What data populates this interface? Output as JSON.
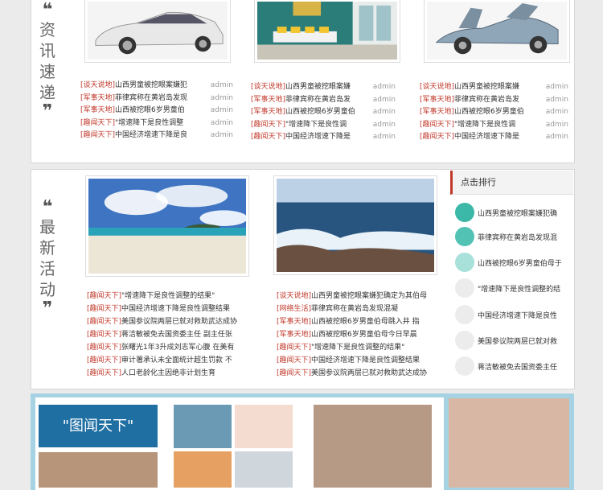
{
  "section1": {
    "title_chars": [
      "资",
      "讯",
      "速",
      "递"
    ],
    "columns": [
      {
        "items": [
          {
            "tag": "[谈天说地]",
            "text": "山西男童被挖眼案嫌犯",
            "author": "admin"
          },
          {
            "tag": "[军事天地]",
            "text": "菲律宾称在黄岩岛发现",
            "author": "admin"
          },
          {
            "tag": "[军事天地]",
            "text": "山西被挖眼6岁男童伯",
            "author": "admin"
          },
          {
            "tag": "[趣闻天下]",
            "text": "\"增速降下是良性调整",
            "author": "admin"
          },
          {
            "tag": "[趣闻天下]",
            "text": "中国经济增速下降是良",
            "author": "admin"
          }
        ]
      },
      {
        "items": [
          {
            "tag": "[谈天说地]",
            "text": "山西男童被挖眼案嫌",
            "author": "admin"
          },
          {
            "tag": "[军事天地]",
            "text": "菲律宾称在黄岩岛发",
            "author": "admin"
          },
          {
            "tag": "[军事天地]",
            "text": "山西被挖眼6岁男童伯",
            "author": "admin"
          },
          {
            "tag": "[趣闻天下]",
            "text": "\"增速降下是良性调",
            "author": "admin"
          },
          {
            "tag": "[趣闻天下]",
            "text": "中国经济增速下降是",
            "author": "admin"
          }
        ]
      },
      {
        "items": [
          {
            "tag": "[谈天说地]",
            "text": "山西男童被挖眼案嫌",
            "author": "admin"
          },
          {
            "tag": "[军事天地]",
            "text": "菲律宾称在黄岩岛发",
            "author": "admin"
          },
          {
            "tag": "[军事天地]",
            "text": "山西被挖眼6岁男童伯",
            "author": "admin"
          },
          {
            "tag": "[趣闻天下]",
            "text": "\"增速降下是良性调",
            "author": "admin"
          },
          {
            "tag": "[趣闻天下]",
            "text": "中国经济增速下降是",
            "author": "admin"
          }
        ]
      }
    ]
  },
  "section2": {
    "title_chars": [
      "最",
      "新",
      "活",
      "动"
    ],
    "left_list": [
      {
        "tag": "[趣闻天下]",
        "text": "\"增速降下是良性调整的结果\""
      },
      {
        "tag": "[趣闻天下]",
        "text": "中国经济增速下降是良性调整结果"
      },
      {
        "tag": "[趣闻天下]",
        "text": "美国参议院两层已就对救助武达成协"
      },
      {
        "tag": "[趣闻天下]",
        "text": "蒋洁敏被免去国资委主任 副主任张"
      },
      {
        "tag": "[趣闻天下]",
        "text": "张曙光1年3升成刘志军心腹 在美有"
      },
      {
        "tag": "[趣闻天下]",
        "text": "审计署承认未全面统计超生罚款 不"
      },
      {
        "tag": "[趣闻天下]",
        "text": "人口老龄化主因绝非计划生育"
      }
    ],
    "right_list": [
      {
        "tag": "[谈天说地]",
        "text": "山西男童被挖眼案嫌犯确定为其伯母"
      },
      {
        "tag": "[网络生活]",
        "text": "菲律宾称在黄岩岛发现混凝"
      },
      {
        "tag": "[军事天地]",
        "text": "山西被挖眼6岁男童伯母跳入井 指"
      },
      {
        "tag": "[军事天地]",
        "text": "山西被挖眼6岁男童伯母今日早晨"
      },
      {
        "tag": "[趣闻天下]",
        "text": "\"增速降下是良性调整的结果\""
      },
      {
        "tag": "[趣闻天下]",
        "text": "中国经济增速下降是良性调整结果"
      },
      {
        "tag": "[趣闻天下]",
        "text": "美国参议院两层已就对救助武达成协"
      }
    ]
  },
  "ranking": {
    "header": "点击排行",
    "items": [
      {
        "text": "山西男童被挖眼案嫌犯确"
      },
      {
        "text": "菲律宾称在黄岩岛发现混"
      },
      {
        "text": "山西被挖眼6岁男童伯母于"
      },
      {
        "text": "\"增速降下是良性调整的结"
      },
      {
        "text": "中国经济增速下降是良性"
      },
      {
        "text": "美国参议院两层已就对救"
      },
      {
        "text": "蒋洁敏被免去国资委主任"
      }
    ],
    "dot_colors": [
      "#3bb8a8",
      "#52c2b4",
      "#a8e0da",
      "#ececec",
      "#ececec",
      "#ececec",
      "#ececec"
    ]
  },
  "section3": {
    "banner": "\"图闻天下\"",
    "accent": "#1f6fa3",
    "frame": "#a6d3e3"
  },
  "colors": {
    "tag_red": "#c0392b",
    "author_gray": "#999999"
  }
}
